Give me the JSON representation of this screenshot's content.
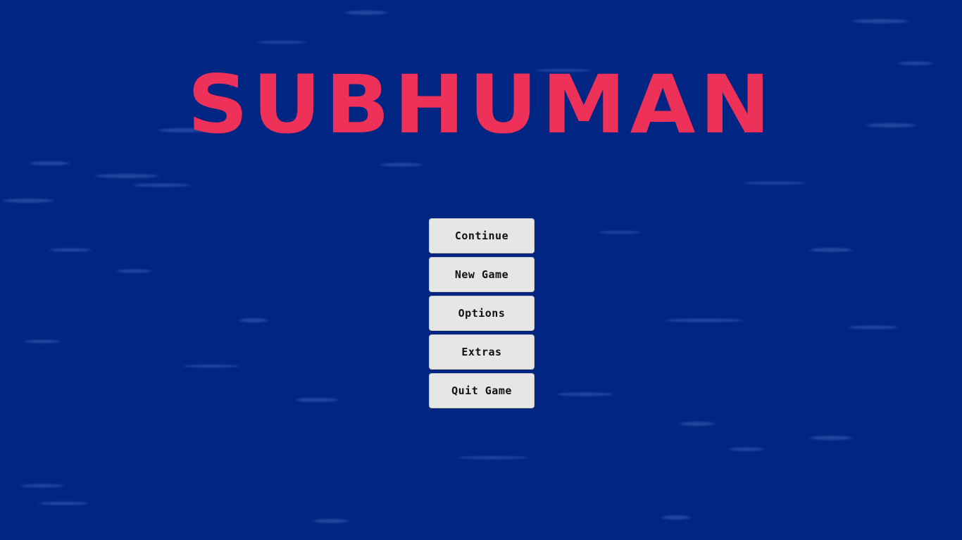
{
  "game": {
    "title": "SUBHUMAN"
  },
  "menu": {
    "buttons": [
      {
        "label": "Continue"
      },
      {
        "label": "New Game"
      },
      {
        "label": "Options"
      },
      {
        "label": "Extras"
      },
      {
        "label": "Quit Game"
      }
    ]
  },
  "colors": {
    "background": "#002582",
    "title": "#ee3158",
    "button": "#e6e6e6",
    "button_text": "#111111"
  }
}
